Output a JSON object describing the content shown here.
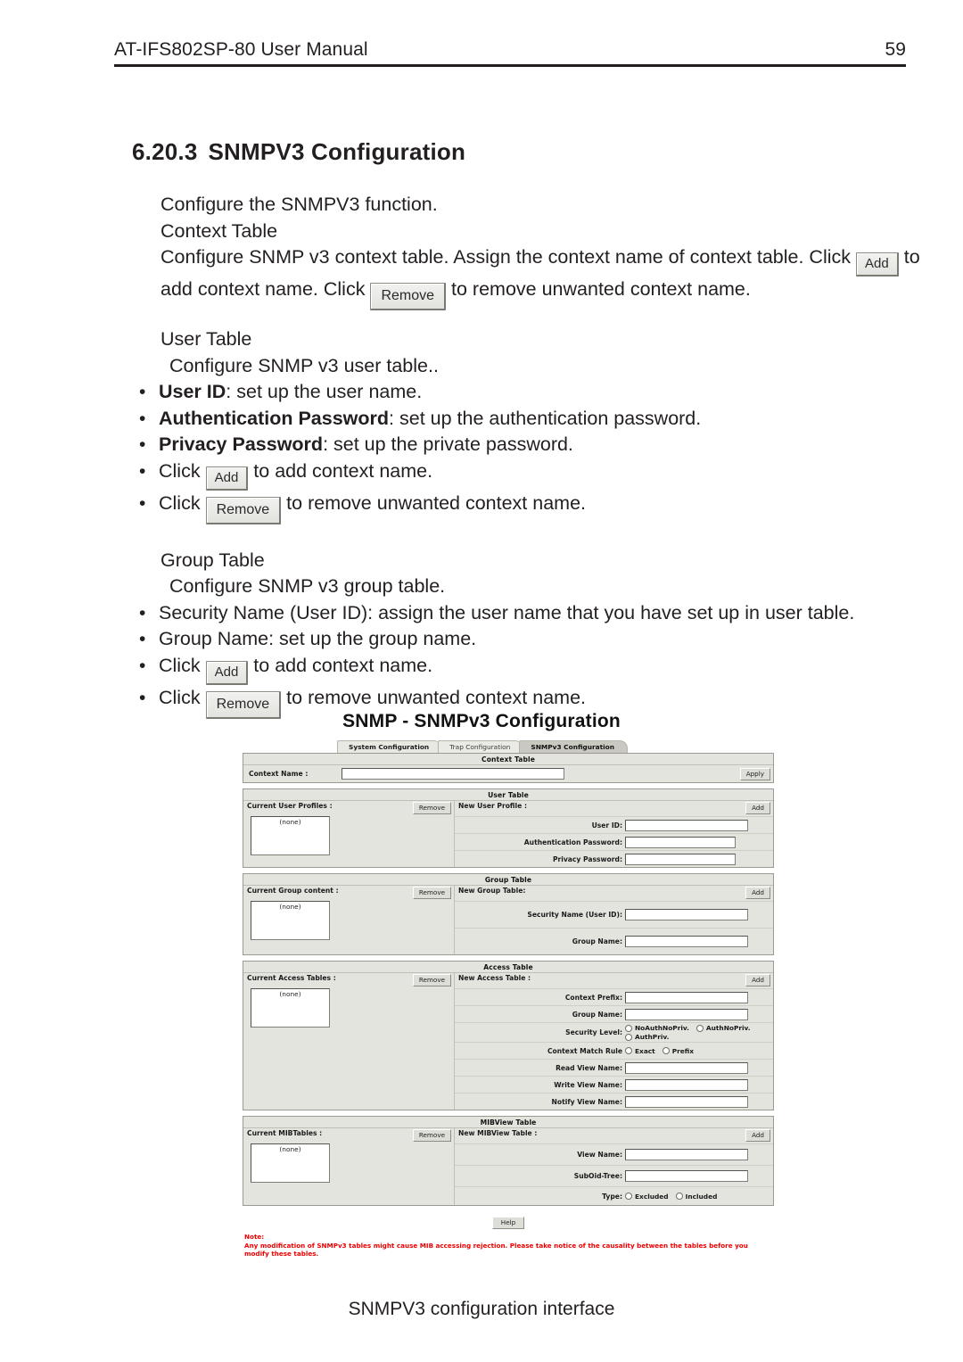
{
  "header": {
    "manual_title": "AT-IFS802SP-80 User Manual",
    "page_number": "59"
  },
  "section": {
    "number": "6.20.3",
    "title": "SNMPV3 Configuration"
  },
  "body": {
    "intro": "Configure the SNMPV3 function.",
    "context_table_heading": "Context Table",
    "context_para_1": "Configure SNMP v3 context table. Assign the context name of context table. Click",
    "context_para_2": "to add context name. Click",
    "context_para_3": "to remove unwanted context name.",
    "user_table_heading": "User Table",
    "user_table_sub": "Configure SNMP v3 user table..",
    "user_bullets": [
      {
        "bold": "User ID",
        "rest": ": set up the user name."
      },
      {
        "bold": "Authentication Password",
        "rest": ": set up the authentication password."
      },
      {
        "bold": "Privacy Password",
        "rest": ": set up the private password."
      }
    ],
    "click_word": "Click",
    "add_button_label": "Add",
    "remove_button_label": "Remove",
    "to_add_context": "to add context name.",
    "to_remove_context": "to remove unwanted context name.",
    "group_table_heading": "Group Table",
    "group_table_sub": "Configure SNMP v3 group table.",
    "group_bullets": [
      "Security Name (User ID): assign the user name that you have set up in user table.",
      "Group Name: set up the group name."
    ],
    "bullet_glyph": "•"
  },
  "gui": {
    "title": "SNMP - SNMPv3 Configuration",
    "tabs": [
      {
        "label": "System Configuration",
        "active": false
      },
      {
        "label": "Trap Configuration",
        "active": false
      },
      {
        "label": "SNMPv3 Configuration",
        "active": true
      }
    ],
    "context_table": {
      "panel_title": "Context Table",
      "label": "Context Name :",
      "value": "",
      "apply_label": "Apply"
    },
    "user_table": {
      "panel_title": "User Table",
      "left_label": "Current User Profiles :",
      "remove_label": "Remove",
      "list_value": "(none)",
      "right_label": "New User Profile :",
      "add_label": "Add",
      "fields": [
        {
          "label": "User ID:",
          "value": ""
        },
        {
          "label": "Authentication Password:",
          "value": ""
        },
        {
          "label": "Privacy Password:",
          "value": ""
        }
      ]
    },
    "group_table": {
      "panel_title": "Group Table",
      "left_label": "Current Group content :",
      "remove_label": "Remove",
      "list_value": "(none)",
      "right_label": "New Group Table:",
      "add_label": "Add",
      "fields": [
        {
          "label": "Security Name (User ID):",
          "value": ""
        },
        {
          "label": "Group Name:",
          "value": ""
        }
      ]
    },
    "access_table": {
      "panel_title": "Access Table",
      "left_label": "Current Access Tables :",
      "remove_label": "Remove",
      "list_value": "(none)",
      "right_label": "New Access Table :",
      "add_label": "Add",
      "fields": [
        {
          "label": "Context Prefix:",
          "value": ""
        },
        {
          "label": "Group Name:",
          "value": ""
        }
      ],
      "security_level_label": "Security Level:",
      "security_level_options": [
        "NoAuthNoPriv.",
        "AuthNoPriv.",
        "AuthPriv."
      ],
      "context_match_label": "Context Match Rule",
      "context_match_options": [
        "Exact",
        "Prefix"
      ],
      "view_fields": [
        {
          "label": "Read View Name:",
          "value": ""
        },
        {
          "label": "Write View Name:",
          "value": ""
        },
        {
          "label": "Notify View Name:",
          "value": ""
        }
      ]
    },
    "mibview_table": {
      "panel_title": "MIBView Table",
      "left_label": "Current MIBTables :",
      "remove_label": "Remove",
      "list_value": "(none)",
      "right_label": "New MIBView Table :",
      "add_label": "Add",
      "fields": [
        {
          "label": "View Name:",
          "value": ""
        },
        {
          "label": "SubOid-Tree:",
          "value": ""
        }
      ],
      "type_label": "Type:",
      "type_options": [
        "Excluded",
        "Included"
      ]
    },
    "help_label": "Help",
    "note_title": "Note:",
    "note_text": "Any modification of SNMPv3 tables might cause MIB accessing rejection. Please take notice of the causality between the tables before you modify these tables."
  },
  "caption": "SNMPV3 configuration interface",
  "colors": {
    "text": "#231f20",
    "note_red": "#ee0000",
    "panel_bg": "#e4e4df",
    "tab_active": "#c9c9c1"
  }
}
